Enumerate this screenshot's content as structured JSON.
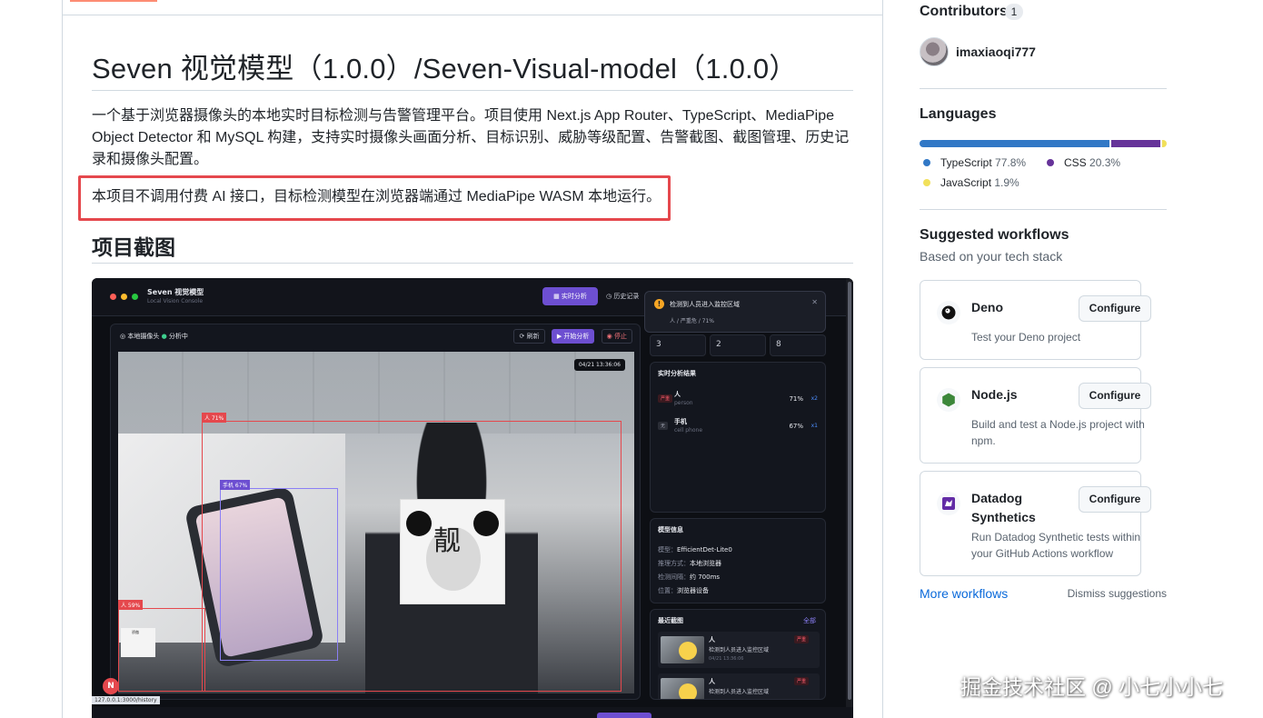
{
  "readme": {
    "title": "Seven 视觉模型（1.0.0）/Seven-Visual-model（1.0.0）",
    "intro": "一个基于浏览器摄像头的本地实时目标检测与告警管理平台。项目使用 Next.js App Router、TypeScript、MediaPipe Object Detector 和 MySQL 构建，支持实时摄像头画面分析、目标识别、威胁等级配置、告警截图、截图管理、历史记录和摄像头配置。",
    "note": "本项目不调用付费 AI 接口，目标检测模型在浏览器端通过 MediaPipe WASM 本地运行。",
    "screenshots_heading": "项目截图"
  },
  "screenshot": {
    "app_name": "Seven 视觉模型",
    "app_sub": "Local Vision Console",
    "btn_live": "实时分析",
    "btn_history": "历史记录",
    "toast": {
      "title": "检测到人员进入监控区域",
      "detail": "人 / 严重危 / 71%"
    },
    "stats": [
      "3",
      "2",
      "8"
    ],
    "camera": {
      "label": "本地摄像头",
      "status": "分析中",
      "refresh": "刷新",
      "start": "开始分析",
      "stop": "停止"
    },
    "timestamp": "04/21 13:36:06",
    "boxes": {
      "person": "人 71%",
      "phone": "手机 67%",
      "person2": "人 59%"
    },
    "panda_char": "靓",
    "mini_label": "骄傲",
    "results": {
      "title": "实时分析结果",
      "rows": [
        {
          "badge": "严重",
          "name": "人",
          "en": "person",
          "pct": "71%",
          "count": "x2"
        },
        {
          "badge": "无",
          "name": "手机",
          "en": "cell phone",
          "pct": "67%",
          "count": "x1"
        }
      ]
    },
    "model": {
      "title": "模型信息",
      "rows": [
        {
          "k": "模型：",
          "v": "EfficientDet-Lite0"
        },
        {
          "k": "推理方式：",
          "v": "本地浏览器"
        },
        {
          "k": "检测间隔：",
          "v": "约 700ms"
        },
        {
          "k": "位置：",
          "v": "浏览器设备"
        }
      ]
    },
    "recent": {
      "title": "最近截图",
      "all": "全部",
      "rows": [
        {
          "name": "人",
          "desc": "检测到人员进入监控区域",
          "time": "04/21 13:36:06",
          "sev": "严重"
        },
        {
          "name": "人",
          "desc": "检测到人员进入监控区域",
          "time": "",
          "sev": "严重"
        }
      ]
    },
    "n_badge": "N",
    "url_tip": "127.0.0.1:3000/history"
  },
  "sidebar": {
    "contributors": {
      "heading": "Contributors",
      "count": "1",
      "user": "imaxiaoqi777"
    },
    "languages": {
      "heading": "Languages",
      "items": [
        {
          "name": "TypeScript",
          "pct": "77.8%",
          "value": 77.8,
          "color": "#3178c6"
        },
        {
          "name": "CSS",
          "pct": "20.3%",
          "value": 20.3,
          "color": "#663399"
        },
        {
          "name": "JavaScript",
          "pct": "1.9%",
          "value": 1.9,
          "color": "#f1e05a"
        }
      ]
    },
    "workflows": {
      "heading": "Suggested workflows",
      "sub": "Based on your tech stack",
      "configure": "Configure",
      "items": [
        {
          "name": "Deno",
          "desc": "Test your Deno project"
        },
        {
          "name": "Node.js",
          "desc": "Build and test a Node.js project with npm."
        },
        {
          "name": "Datadog Synthetics",
          "desc": "Run Datadog Synthetic tests within your GitHub Actions workflow"
        }
      ],
      "more": "More workflows",
      "dismiss": "Dismiss suggestions"
    }
  },
  "watermark": "掘金技术社区 @ 小七小小七"
}
